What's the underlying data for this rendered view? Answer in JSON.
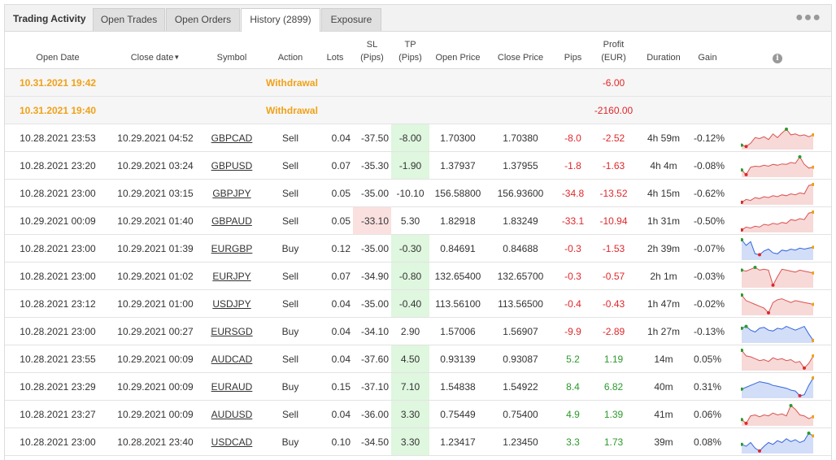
{
  "tabs": {
    "title": "Trading Activity",
    "items": [
      "Open Trades",
      "Open Orders",
      "History (2899)",
      "Exposure"
    ],
    "active_index": 2,
    "more_icon": "more-dots-icon"
  },
  "columns": {
    "open_date": "Open Date",
    "close_date": "Close date",
    "symbol": "Symbol",
    "action": "Action",
    "lots": "Lots",
    "sl": "SL",
    "sl_unit": "(Pips)",
    "tp": "TP",
    "tp_unit": "(Pips)",
    "open_price": "Open Price",
    "close_price": "Close Price",
    "pips": "Pips",
    "profit": "Profit",
    "profit_unit": "(EUR)",
    "duration": "Duration",
    "gain": "Gain",
    "info_icon": "i"
  },
  "colors": {
    "withdrawal": "#f0a118",
    "negative": "#e0272a",
    "positive": "#2b9a2b",
    "tp_bg": "#dff6df",
    "sl_bg": "#fbe0e0",
    "spark_sell": "#d9534f",
    "spark_buy": "#3366dd"
  },
  "withdrawals": [
    {
      "open_date": "10.31.2021 19:42",
      "action": "Withdrawal",
      "profit": "-6.00"
    },
    {
      "open_date": "10.31.2021 19:40",
      "action": "Withdrawal",
      "profit": "-2160.00"
    }
  ],
  "trades": [
    {
      "open_date": "10.28.2021 23:53",
      "close_date": "10.29.2021 04:52",
      "symbol": "GBPCAD",
      "action": "Sell",
      "lots": "0.04",
      "sl": "-37.50",
      "tp": "-8.00",
      "open_price": "1.70300",
      "close_price": "1.70380",
      "pips": "-8.0",
      "profit": "-2.52",
      "duration": "4h 59m",
      "gain": "-0.12%",
      "hl": "tp",
      "dir": "neg",
      "spark": [
        0.15,
        0.08,
        0.25,
        0.55,
        0.5,
        0.6,
        0.45,
        0.75,
        0.55,
        0.8,
        1.0,
        0.7,
        0.75,
        0.65,
        0.7,
        0.6,
        0.7
      ]
    },
    {
      "open_date": "10.28.2021 23:20",
      "close_date": "10.29.2021 03:24",
      "symbol": "GBPUSD",
      "action": "Sell",
      "lots": "0.07",
      "sl": "-35.30",
      "tp": "-1.90",
      "open_price": "1.37937",
      "close_price": "1.37955",
      "pips": "-1.8",
      "profit": "-1.63",
      "duration": "4h 4m",
      "gain": "-0.08%",
      "hl": "tp",
      "dir": "neg",
      "spark": [
        0.3,
        0.05,
        0.45,
        0.5,
        0.48,
        0.55,
        0.5,
        0.6,
        0.55,
        0.62,
        0.6,
        0.7,
        0.65,
        1.0,
        0.6,
        0.4,
        0.45
      ]
    },
    {
      "open_date": "10.28.2021 23:00",
      "close_date": "10.29.2021 03:15",
      "symbol": "GBPJPY",
      "action": "Sell",
      "lots": "0.05",
      "sl": "-35.00",
      "tp": "-10.10",
      "open_price": "156.58800",
      "close_price": "156.93600",
      "pips": "-34.8",
      "profit": "-13.52",
      "duration": "4h 15m",
      "gain": "-0.62%",
      "hl": "none",
      "dir": "neg",
      "spark": [
        0.05,
        0.2,
        0.15,
        0.3,
        0.25,
        0.35,
        0.3,
        0.4,
        0.35,
        0.45,
        0.4,
        0.5,
        0.45,
        0.55,
        0.5,
        0.95,
        1.0
      ]
    },
    {
      "open_date": "10.29.2021 00:09",
      "close_date": "10.29.2021 01:40",
      "symbol": "GBPAUD",
      "action": "Sell",
      "lots": "0.05",
      "sl": "-33.10",
      "tp": "5.30",
      "open_price": "1.82918",
      "close_price": "1.83249",
      "pips": "-33.1",
      "profit": "-10.94",
      "duration": "1h 31m",
      "gain": "-0.50%",
      "hl": "sl",
      "dir": "neg",
      "spark": [
        0.05,
        0.2,
        0.15,
        0.25,
        0.2,
        0.35,
        0.3,
        0.4,
        0.35,
        0.45,
        0.4,
        0.6,
        0.55,
        0.65,
        0.6,
        0.95,
        1.0
      ]
    },
    {
      "open_date": "10.28.2021 23:00",
      "close_date": "10.29.2021 01:39",
      "symbol": "EURGBP",
      "action": "Buy",
      "lots": "0.12",
      "sl": "-35.00",
      "tp": "-0.30",
      "open_price": "0.84691",
      "close_price": "0.84688",
      "pips": "-0.3",
      "profit": "-1.53",
      "duration": "2h 39m",
      "gain": "-0.07%",
      "hl": "tp",
      "dir": "neg",
      "spark": [
        1.0,
        0.7,
        0.9,
        0.25,
        0.2,
        0.4,
        0.5,
        0.3,
        0.25,
        0.45,
        0.4,
        0.5,
        0.45,
        0.55,
        0.5,
        0.55,
        0.6
      ]
    },
    {
      "open_date": "10.28.2021 23:00",
      "close_date": "10.29.2021 01:02",
      "symbol": "EURJPY",
      "action": "Sell",
      "lots": "0.07",
      "sl": "-34.90",
      "tp": "-0.80",
      "open_price": "132.65400",
      "close_price": "132.65700",
      "pips": "-0.3",
      "profit": "-0.57",
      "duration": "2h 1m",
      "gain": "-0.03%",
      "hl": "tp",
      "dir": "neg",
      "spark": [
        0.85,
        0.8,
        0.9,
        1.0,
        0.85,
        0.9,
        0.85,
        0.05,
        0.5,
        0.9,
        0.85,
        0.8,
        0.75,
        0.85,
        0.8,
        0.75,
        0.7
      ]
    },
    {
      "open_date": "10.28.2021 23:12",
      "close_date": "10.29.2021 01:00",
      "symbol": "USDJPY",
      "action": "Sell",
      "lots": "0.04",
      "sl": "-35.00",
      "tp": "-0.40",
      "open_price": "113.56100",
      "close_price": "113.56500",
      "pips": "-0.4",
      "profit": "-0.43",
      "duration": "1h 47m",
      "gain": "-0.02%",
      "hl": "tp",
      "dir": "neg",
      "spark": [
        1.0,
        0.7,
        0.6,
        0.5,
        0.4,
        0.3,
        0.05,
        0.6,
        0.75,
        0.8,
        0.7,
        0.6,
        0.7,
        0.65,
        0.6,
        0.55,
        0.5
      ]
    },
    {
      "open_date": "10.28.2021 23:00",
      "close_date": "10.29.2021 00:27",
      "symbol": "EURSGD",
      "action": "Buy",
      "lots": "0.04",
      "sl": "-34.10",
      "tp": "2.90",
      "open_price": "1.57006",
      "close_price": "1.56907",
      "pips": "-9.9",
      "profit": "-2.89",
      "duration": "1h 27m",
      "gain": "-0.13%",
      "hl": "none",
      "dir": "neg",
      "spark": [
        0.7,
        0.8,
        0.6,
        0.5,
        0.7,
        0.75,
        0.6,
        0.55,
        0.7,
        0.65,
        0.8,
        0.7,
        0.6,
        0.7,
        0.8,
        0.4,
        0.05
      ]
    },
    {
      "open_date": "10.28.2021 23:55",
      "close_date": "10.29.2021 00:09",
      "symbol": "AUDCAD",
      "action": "Sell",
      "lots": "0.04",
      "sl": "-37.60",
      "tp": "4.50",
      "open_price": "0.93139",
      "close_price": "0.93087",
      "pips": "5.2",
      "profit": "1.19",
      "duration": "14m",
      "gain": "0.05%",
      "hl": "tp",
      "dir": "pos",
      "spark": [
        1.0,
        0.7,
        0.65,
        0.55,
        0.45,
        0.5,
        0.4,
        0.6,
        0.5,
        0.55,
        0.45,
        0.5,
        0.35,
        0.4,
        0.05,
        0.3,
        0.7
      ]
    },
    {
      "open_date": "10.28.2021 23:29",
      "close_date": "10.29.2021 00:09",
      "symbol": "EURAUD",
      "action": "Buy",
      "lots": "0.15",
      "sl": "-37.10",
      "tp": "7.10",
      "open_price": "1.54838",
      "close_price": "1.54922",
      "pips": "8.4",
      "profit": "6.82",
      "duration": "40m",
      "gain": "0.31%",
      "hl": "tp",
      "dir": "pos",
      "spark": [
        0.4,
        0.5,
        0.6,
        0.7,
        0.8,
        0.75,
        0.7,
        0.6,
        0.55,
        0.5,
        0.45,
        0.35,
        0.3,
        0.05,
        0.1,
        0.6,
        1.0
      ]
    },
    {
      "open_date": "10.28.2021 23:27",
      "close_date": "10.29.2021 00:09",
      "symbol": "AUDUSD",
      "action": "Sell",
      "lots": "0.04",
      "sl": "-36.00",
      "tp": "3.30",
      "open_price": "0.75449",
      "close_price": "0.75400",
      "pips": "4.9",
      "profit": "1.39",
      "duration": "41m",
      "gain": "0.06%",
      "hl": "tp",
      "dir": "pos",
      "spark": [
        0.25,
        0.05,
        0.45,
        0.5,
        0.4,
        0.5,
        0.45,
        0.6,
        0.5,
        0.55,
        0.45,
        1.0,
        0.8,
        0.5,
        0.45,
        0.3,
        0.4
      ]
    },
    {
      "open_date": "10.28.2021 23:00",
      "close_date": "10.28.2021 23:40",
      "symbol": "USDCAD",
      "action": "Buy",
      "lots": "0.10",
      "sl": "-34.50",
      "tp": "3.30",
      "open_price": "1.23417",
      "close_price": "1.23450",
      "pips": "3.3",
      "profit": "1.73",
      "duration": "39m",
      "gain": "0.08%",
      "hl": "tp",
      "dir": "pos",
      "spark": [
        0.4,
        0.3,
        0.5,
        0.2,
        0.05,
        0.3,
        0.5,
        0.4,
        0.6,
        0.5,
        0.7,
        0.55,
        0.65,
        0.5,
        0.6,
        1.0,
        0.85
      ]
    }
  ]
}
